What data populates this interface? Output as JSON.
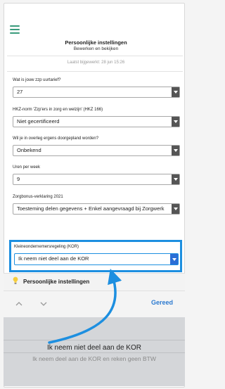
{
  "header": {
    "title": "Persoonlijke instellingen",
    "subtitle": "Bewerken en bekijken",
    "updated": "Laatst bijgewerkt: 28 jun 15:26"
  },
  "fields": [
    {
      "label": "Wat is jouw zzp uurtarief?",
      "value": "27"
    },
    {
      "label": "HKZ-norm 'Zzp'ers in zorg en welzijn' (HKZ 166)",
      "value": "Niet gecertificeerd"
    },
    {
      "label": "Wil je in overleg ergens doorgepland worden?",
      "value": "Onbekend"
    },
    {
      "label": "Uren per week",
      "value": "9"
    },
    {
      "label": "Zorgbonus-verklaring 2021",
      "value": "Toesteming delen gegevens + Enkel aangevraagd bij Zorgwerk"
    }
  ],
  "kor": {
    "label": "Kleineondernemersregeling (KOR)",
    "value": "Ik neem niet deel aan de KOR"
  },
  "bar": {
    "text": "Persoonlijke instellingen",
    "icon": "lightbulb-icon"
  },
  "toolbar": {
    "done": "Gereed"
  },
  "picker": {
    "options": [
      "Ik neem niet deel aan de KOR",
      "Ik neem deel aan de KOR en reken geen BTW"
    ]
  },
  "colors": {
    "accent": "#1d8fe0",
    "menu": "#3a9b7c",
    "done": "#2c7ad0"
  }
}
